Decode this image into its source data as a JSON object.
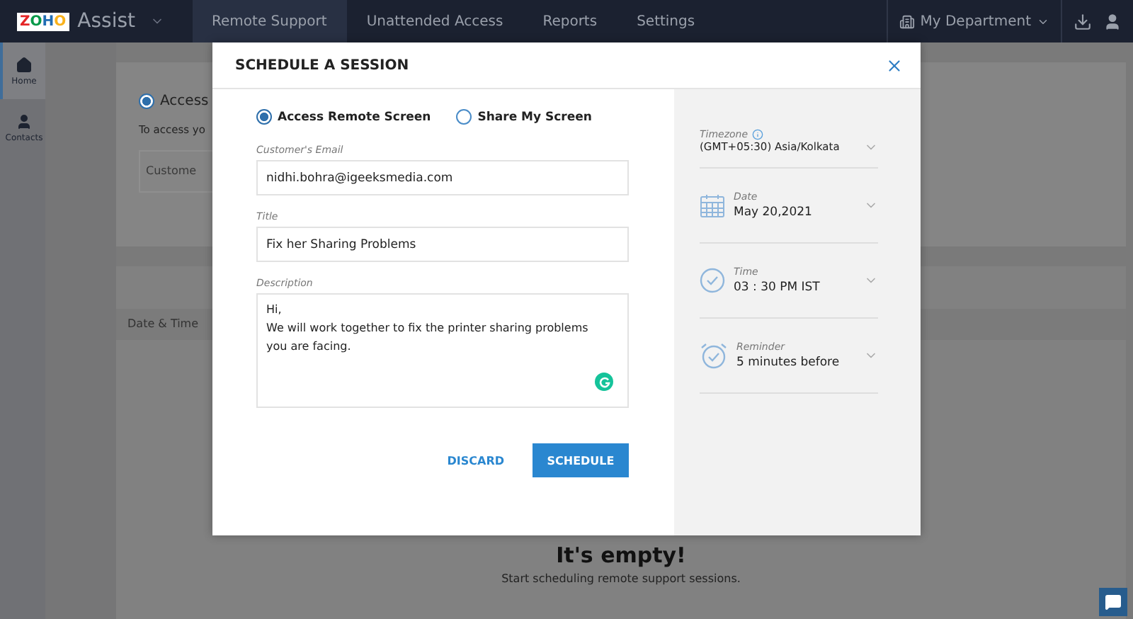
{
  "topbar": {
    "logo": "ZOHO",
    "app_name": "Assist",
    "tabs": [
      {
        "label": "Remote Support",
        "selected": true
      },
      {
        "label": "Unattended Access",
        "selected": false
      },
      {
        "label": "Reports",
        "selected": false
      },
      {
        "label": "Settings",
        "selected": false
      }
    ],
    "department": "My Department"
  },
  "sidebar": {
    "items": [
      {
        "label": "Home",
        "selected": true
      },
      {
        "label": "Contacts",
        "selected": false
      }
    ]
  },
  "background": {
    "radio_selected": true,
    "radio_label": "Access",
    "instruction": "To access yo",
    "email_placeholder": "Custome",
    "table_column": "Date & Time",
    "empty_title": "It's empty!",
    "empty_subtitle": "Start scheduling remote support sessions."
  },
  "dialog": {
    "title": "SCHEDULE A SESSION",
    "modes": [
      {
        "label": "Access Remote Screen",
        "selected": true
      },
      {
        "label": "Share My Screen",
        "selected": false
      }
    ],
    "fields": [
      {
        "label": "Customer's Email",
        "value": "nidhi.bohra@igeeksmedia.com",
        "kind": "input"
      },
      {
        "label": "Title",
        "value": "Fix her Sharing Problems",
        "kind": "input"
      },
      {
        "label": "Description",
        "value": "Hi,\nWe will work together to fix the printer sharing problems\nyou are facing.",
        "kind": "textarea"
      }
    ],
    "buttons": [
      {
        "label": "DISCARD",
        "kind": "text"
      },
      {
        "label": "SCHEDULE",
        "kind": "primary"
      }
    ],
    "settings": [
      {
        "label": "Timezone",
        "value": "(GMT+05:30) Asia/Kolkata"
      },
      {
        "label": "Date",
        "value": "May 20,2021"
      },
      {
        "label": "Time",
        "value": "03 : 30 PM IST"
      },
      {
        "label": "Reminder",
        "value": "5 minutes before"
      }
    ]
  }
}
